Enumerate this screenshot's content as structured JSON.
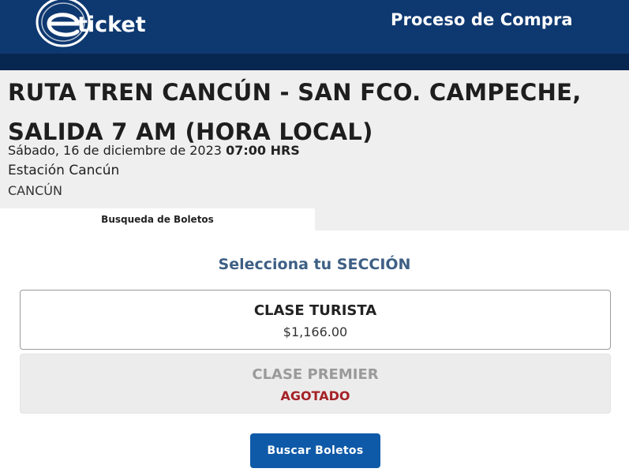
{
  "header": {
    "logo_text": "ticket",
    "title": "Proceso de Compra"
  },
  "event": {
    "title": "RUTA TREN CANCÚN - SAN FCO. CAMPECHE, SALIDA 7 AM (HORA LOCAL)",
    "date": "Sábado, 16 de diciembre de 2023",
    "time": "07:00 HRS",
    "venue": "Estación Cancún",
    "city": "CANCÚN"
  },
  "tabs": [
    {
      "label": "Busqueda de Boletos",
      "active": true
    }
  ],
  "section": {
    "heading": "Selecciona tu SECCIÓN",
    "options": [
      {
        "name": "CLASE TURISTA",
        "price": "$1,166.00",
        "available": true
      },
      {
        "name": "CLASE PREMIER",
        "status": "AGOTADO",
        "available": false
      }
    ]
  },
  "actions": {
    "search_label": "Buscar Boletos"
  },
  "colors": {
    "header_bg": "#0e3870",
    "header_strip": "#072650",
    "heading_text": "#3e5f85",
    "button_bg": "#0f5aa8",
    "sold_out": "#a52226"
  }
}
